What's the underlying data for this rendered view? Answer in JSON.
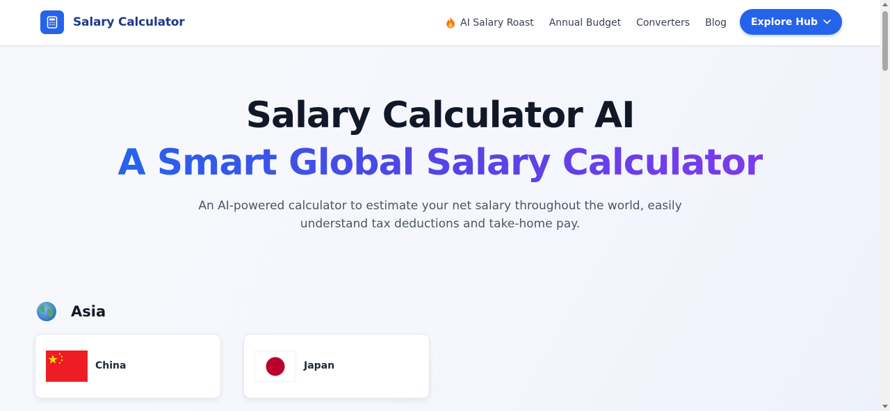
{
  "brand": {
    "name": "Salary Calculator",
    "logo_icon": "calculator-icon",
    "accent": "#2563eb"
  },
  "nav": {
    "links": [
      {
        "label": "AI Salary Roast",
        "icon": "flame-icon"
      },
      {
        "label": "Annual Budget"
      },
      {
        "label": "Converters"
      },
      {
        "label": "Blog"
      }
    ],
    "cta": {
      "label": "Explore Hub",
      "icon": "chevron-down-icon",
      "color": "#2563eb"
    }
  },
  "hero": {
    "title": "Salary Calculator AI",
    "subtitle": "A Smart Global Salary Calculator",
    "gradient": [
      "#2563eb",
      "#4f46e5",
      "#7c3aed"
    ],
    "description": "An AI-powered calculator to estimate your net salary throughout the world, easily understand tax deductions and take-home pay."
  },
  "regions": [
    {
      "name": "Asia",
      "icon": "globe-icon",
      "countries": [
        {
          "name": "China",
          "flag": "china-flag-icon"
        },
        {
          "name": "Japan",
          "flag": "japan-flag-icon"
        }
      ]
    }
  ]
}
